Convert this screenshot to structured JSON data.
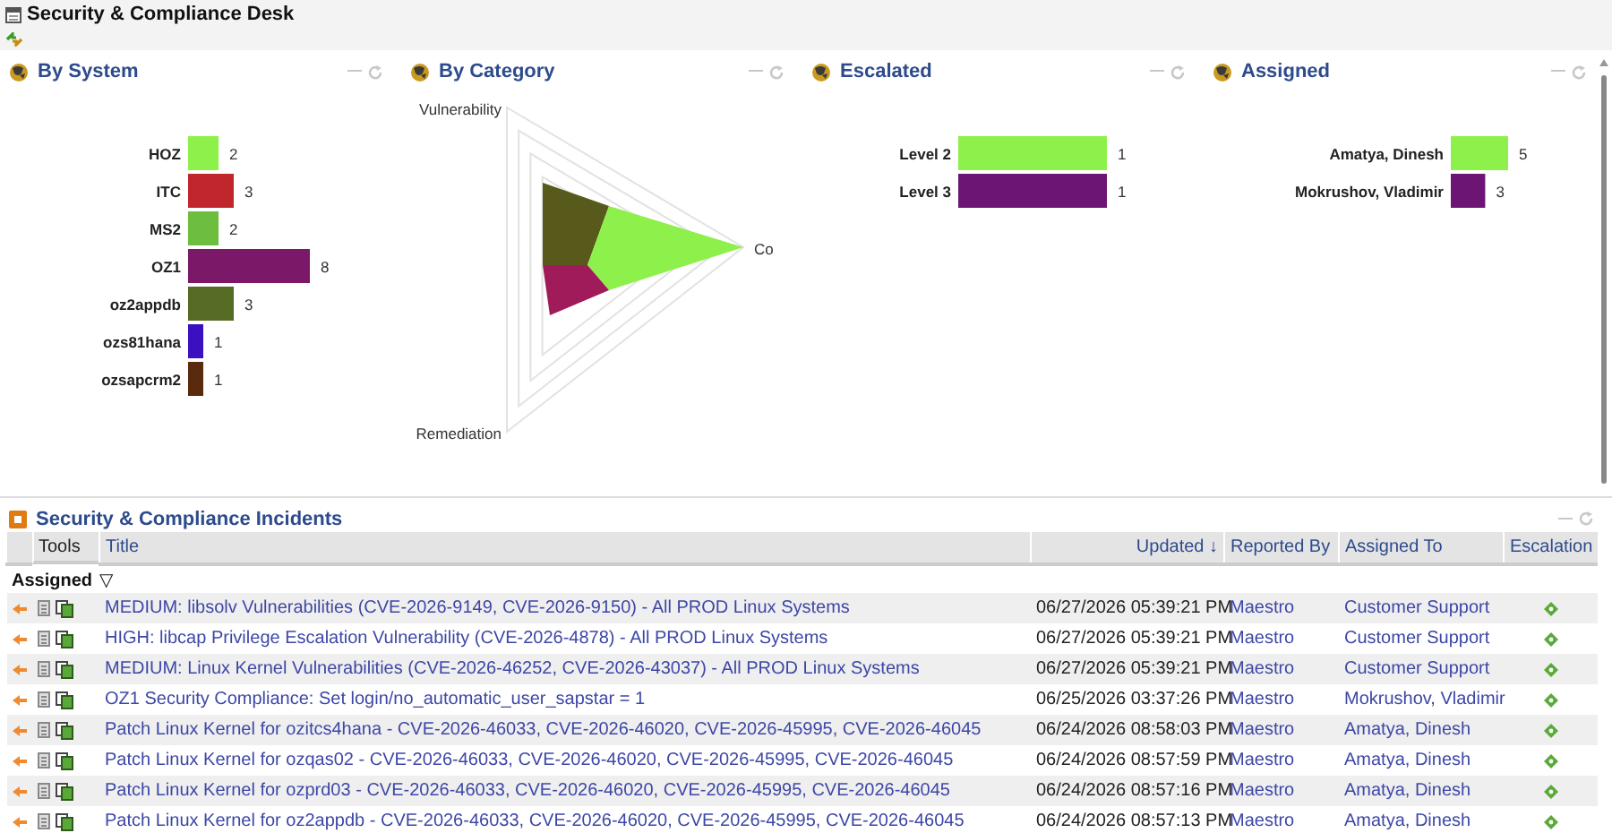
{
  "window": {
    "title": "Security & Compliance Desk"
  },
  "dashboard": [
    {
      "kind": "bar",
      "title": "By System",
      "chart_data": {
        "type": "bar",
        "orientation": "horizontal",
        "categories": [
          "HOZ",
          "ITC",
          "MS2",
          "OZ1",
          "oz2appdb",
          "ozs81hana",
          "ozsapcrm2"
        ],
        "series": [
          {
            "values": [
              2,
              3,
              2,
              8,
              3,
              1,
              1
            ]
          }
        ],
        "colors": [
          "#8ef04a",
          "#c0272d",
          "#6dbd3f",
          "#7b1868",
          "#566b24",
          "#3b10c0",
          "#5a2a0e"
        ],
        "data_labels": true
      }
    },
    {
      "kind": "radar",
      "title": "By Category",
      "axes": [
        "Vulnerability",
        "Co",
        "Remediation"
      ]
    },
    {
      "kind": "bar",
      "title": "Escalated",
      "chart_data": {
        "type": "bar",
        "orientation": "horizontal",
        "categories": [
          "Level 2",
          "Level 3"
        ],
        "series": [
          {
            "values": [
              1,
              1
            ]
          }
        ],
        "colors": [
          "#8ef04a",
          "#6d1574"
        ],
        "data_labels": true
      }
    },
    {
      "kind": "bar",
      "title": "Assigned",
      "chart_data": {
        "type": "bar",
        "orientation": "horizontal",
        "categories": [
          "Amatya, Dinesh",
          "Mokrushov, Vladimir"
        ],
        "series": [
          {
            "values": [
              5,
              3
            ]
          }
        ],
        "colors": [
          "#8ef04a",
          "#6d1574"
        ],
        "data_labels": true
      }
    }
  ],
  "incidents": {
    "title": "Security & Compliance Incidents",
    "columns": [
      "Tools",
      "Title",
      "Updated",
      "Reported By",
      "Assigned To",
      "Escalation"
    ],
    "sort_mark": "↓",
    "group": {
      "label": "Assigned",
      "toggle": "▽"
    },
    "rows": [
      {
        "title": "MEDIUM: libsolv Vulnerabilities (CVE-2026-9149, CVE-2026-9150) - All PROD Linux Systems",
        "updated": "06/27/2026 05:39:21 PM",
        "reported_by": "Maestro",
        "assigned_to": "Customer Support"
      },
      {
        "title": "HIGH: libcap Privilege Escalation Vulnerability (CVE-2026-4878) - All PROD Linux Systems",
        "updated": "06/27/2026 05:39:21 PM",
        "reported_by": "Maestro",
        "assigned_to": "Customer Support"
      },
      {
        "title": "MEDIUM: Linux Kernel Vulnerabilities (CVE-2026-46252, CVE-2026-43037) - All PROD Linux Systems",
        "updated": "06/27/2026 05:39:21 PM",
        "reported_by": "Maestro",
        "assigned_to": "Customer Support"
      },
      {
        "title": "OZ1 Security Compliance: Set login/no_automatic_user_sapstar = 1",
        "updated": "06/25/2026 03:37:26 PM",
        "reported_by": "Maestro",
        "assigned_to": "Mokrushov, Vladimir"
      },
      {
        "title": "Patch Linux Kernel for ozitcs4hana - CVE-2026-46033, CVE-2026-46020, CVE-2026-45995, CVE-2026-46045",
        "updated": "06/24/2026 08:58:03 PM",
        "reported_by": "Maestro",
        "assigned_to": "Amatya, Dinesh"
      },
      {
        "title": "Patch Linux Kernel for ozqas02 - CVE-2026-46033, CVE-2026-46020, CVE-2026-45995, CVE-2026-46045",
        "updated": "06/24/2026 08:57:59 PM",
        "reported_by": "Maestro",
        "assigned_to": "Amatya, Dinesh"
      },
      {
        "title": "Patch Linux Kernel for ozprd03 - CVE-2026-46033, CVE-2026-46020, CVE-2026-45995, CVE-2026-46045",
        "updated": "06/24/2026 08:57:16 PM",
        "reported_by": "Maestro",
        "assigned_to": "Amatya, Dinesh"
      },
      {
        "title": "Patch Linux Kernel for oz2appdb - CVE-2026-46033, CVE-2026-46020, CVE-2026-45995, CVE-2026-46045",
        "updated": "06/24/2026 08:57:13 PM",
        "reported_by": "Maestro",
        "assigned_to": "Amatya, Dinesh"
      }
    ]
  }
}
